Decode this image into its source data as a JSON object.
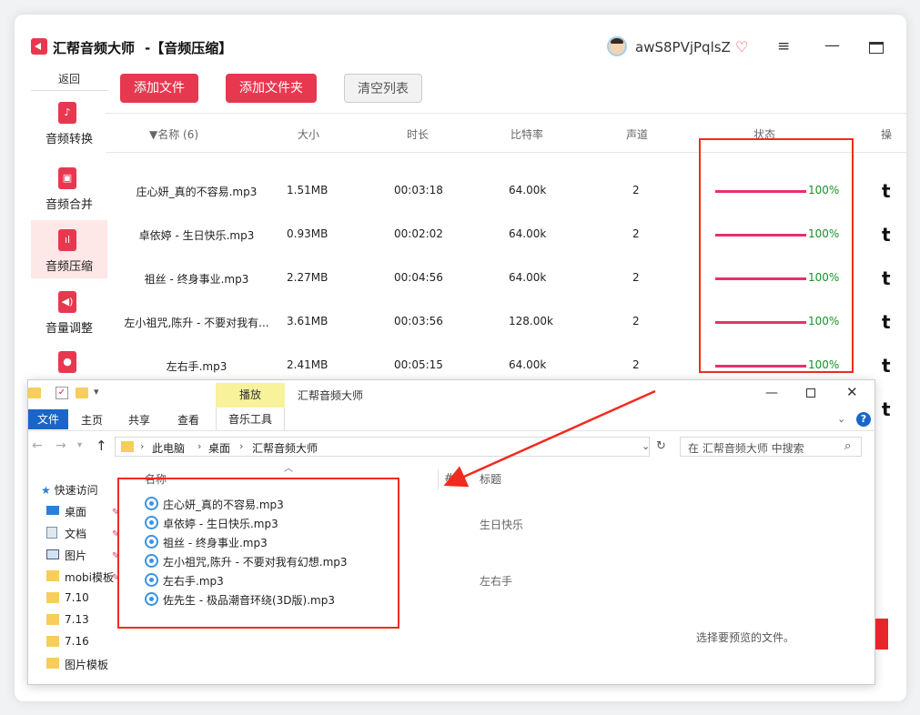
{
  "app": {
    "title": "汇帮音频大师",
    "module": "-【音频压缩】",
    "username": "awS8PVjPqlsZ",
    "icons": {
      "vip": "heart-diamond-icon",
      "menu": "hamburger-icon",
      "minimize": "minimize-icon",
      "maximize": "maximize-icon"
    }
  },
  "sidebar": {
    "back": "返回",
    "items": [
      {
        "label": "音频转换",
        "icon": "audio-convert-icon"
      },
      {
        "label": "音频合并",
        "icon": "audio-merge-icon"
      },
      {
        "label": "音频压缩",
        "icon": "audio-compress-icon",
        "active": true
      },
      {
        "label": "音量调整",
        "icon": "volume-icon"
      },
      {
        "label": "",
        "icon": "microphone-icon"
      }
    ]
  },
  "toolbar": {
    "add_file": "添加文件",
    "add_folder": "添加文件夹",
    "clear_list": "清空列表"
  },
  "table": {
    "headers": {
      "name": "▼名称 (6)",
      "size": "大小",
      "duration": "时长",
      "bitrate": "比特率",
      "channel": "声道",
      "status": "状态",
      "action": "操"
    },
    "rows": [
      {
        "name": "庄心妍_真的不容易.mp3",
        "size": "1.51MB",
        "duration": "00:03:18",
        "bitrate": "64.00k",
        "channel": "2",
        "progress": 100,
        "pct": "100%"
      },
      {
        "name": "卓依婷 - 生日快乐.mp3",
        "size": "0.93MB",
        "duration": "00:02:02",
        "bitrate": "64.00k",
        "channel": "2",
        "progress": 100,
        "pct": "100%"
      },
      {
        "name": "祖丝 - 终身事业.mp3",
        "size": "2.27MB",
        "duration": "00:04:56",
        "bitrate": "64.00k",
        "channel": "2",
        "progress": 100,
        "pct": "100%"
      },
      {
        "name": "左小祖咒,陈升 - 不要对我有...",
        "size": "3.61MB",
        "duration": "00:03:56",
        "bitrate": "128.00k",
        "channel": "2",
        "progress": 100,
        "pct": "100%"
      },
      {
        "name": "左右手.mp3",
        "size": "2.41MB",
        "duration": "00:05:15",
        "bitrate": "64.00k",
        "channel": "2",
        "progress": 100,
        "pct": "100%"
      }
    ],
    "action_glyph": "t"
  },
  "explorer": {
    "title": "汇帮音频大师",
    "context_tab": "播放",
    "ribbon": {
      "file": "文件",
      "home": "主页",
      "share": "共享",
      "view": "查看",
      "music_tools": "音乐工具"
    },
    "breadcrumb": [
      "此电脑",
      "桌面",
      "汇帮音频大师"
    ],
    "search_placeholder": "在 汇帮音频大师 中搜索",
    "nav": {
      "quick_access": "快速访问",
      "items": [
        "桌面",
        "文档",
        "图片",
        "mobi模板",
        "7.10",
        "7.13",
        "7.16",
        "图片模板"
      ]
    },
    "columns": {
      "name": "名称",
      "number": "#",
      "title": "标题"
    },
    "files": [
      {
        "name": "庄心妍_真的不容易.mp3",
        "title": ""
      },
      {
        "name": "卓依婷 - 生日快乐.mp3",
        "title": "生日快乐"
      },
      {
        "name": "祖丝 - 终身事业.mp3",
        "title": ""
      },
      {
        "name": "左小祖咒,陈升 - 不要对我有幻想.mp3",
        "title": ""
      },
      {
        "name": "左右手.mp3",
        "title": "左右手"
      },
      {
        "name": "佐先生 - 极品潮音环绕(3D版).mp3",
        "title": ""
      }
    ],
    "preview": "选择要预览的文件。"
  },
  "colors": {
    "accent": "#e8384f",
    "progress": "#e8306a",
    "pct_text": "#1a8f2a",
    "annotation": "#f02b1f",
    "explorer_blue": "#1a66c8"
  }
}
